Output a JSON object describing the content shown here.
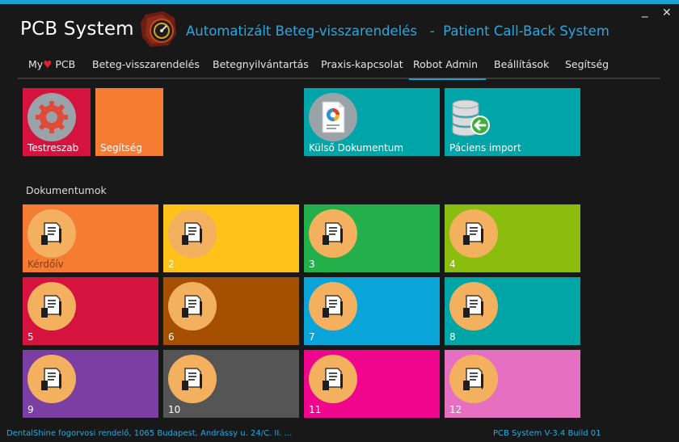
{
  "app": {
    "title": "PCB System",
    "tagline": "Automatizált Beteg-visszarendelés   -  Patient Call-Back System",
    "window_controls": {
      "minimize": "_",
      "close": "✕"
    }
  },
  "menu": {
    "items": [
      {
        "prefix": "My",
        "heart": "♥",
        "suffix": " PCB"
      },
      {
        "label": "Beteg-visszarendelés"
      },
      {
        "label": "Betegnyilvántartás"
      },
      {
        "label": "Praxis-kapcsolat"
      },
      {
        "label": "Robot Admin",
        "active": true
      },
      {
        "label": "Beállítások"
      },
      {
        "label": "Segítség"
      }
    ]
  },
  "top_tiles": [
    {
      "label": "Testreszab",
      "color": "#d4133f",
      "icon": "gear-icon"
    },
    {
      "label": "Segítség",
      "color": "#f47c33",
      "icon": "none"
    },
    {
      "label": "Külső Dokumentum",
      "color": "#00a5a8",
      "icon": "document-chart-icon"
    },
    {
      "label": "Páciens import",
      "color": "#00a5a8",
      "icon": "database-import-icon"
    }
  ],
  "section": {
    "title": "Dokumentumok"
  },
  "documents": [
    {
      "label": "Kérdőív",
      "color": "#f47c33"
    },
    {
      "label": "2",
      "color": "#ffc219"
    },
    {
      "label": "3",
      "color": "#23b04b"
    },
    {
      "label": "4",
      "color": "#8bbd0f"
    },
    {
      "label": "5",
      "color": "#d4133f"
    },
    {
      "label": "6",
      "color": "#a54f00"
    },
    {
      "label": "7",
      "color": "#0aa5d8"
    },
    {
      "label": "8",
      "color": "#00a6a6"
    },
    {
      "label": "9",
      "color": "#7b3fa3"
    },
    {
      "label": "10",
      "color": "#555555"
    },
    {
      "label": "11",
      "color": "#f0068c"
    },
    {
      "label": "12",
      "color": "#e56fc0"
    }
  ],
  "footer": {
    "left": "DentalShine fogorvosi rendelő, 1065 Budapest, Andrássy u. 24/C. II. ...",
    "right": "PCB System V-3.4 Build 01"
  }
}
